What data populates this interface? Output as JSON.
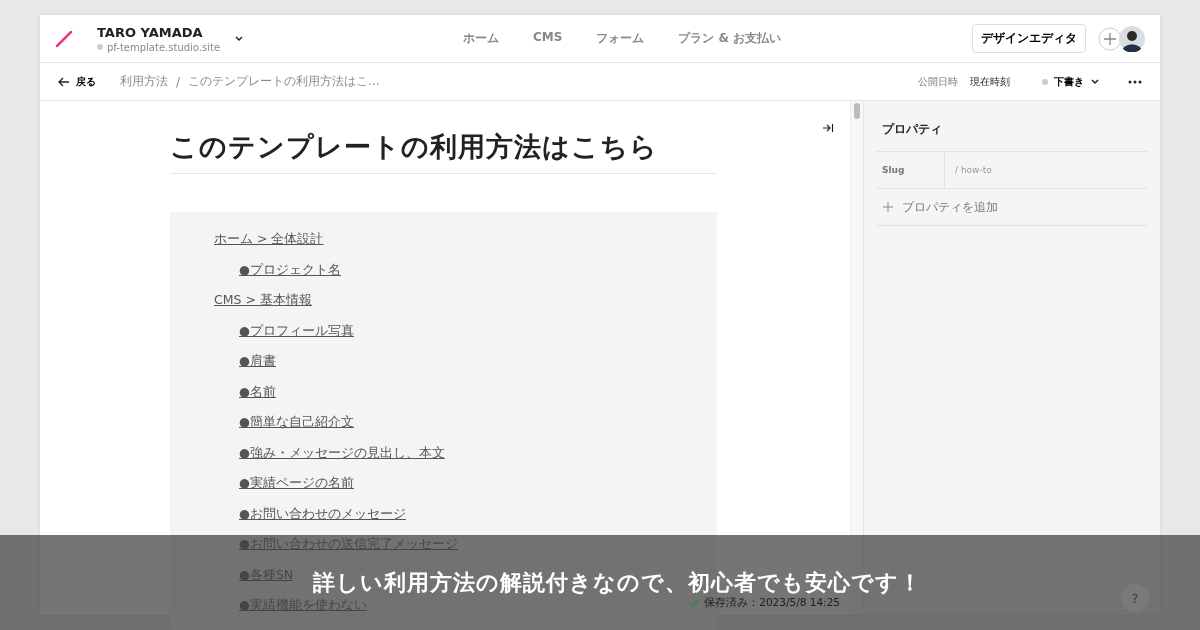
{
  "header": {
    "site_name": "TARO YAMADA",
    "site_url": "pf-template.studio.site",
    "nav": [
      {
        "label": "ホーム",
        "selected": false
      },
      {
        "label": "CMS",
        "selected": false
      },
      {
        "label": "フォーム",
        "selected": false
      },
      {
        "label": "プラン & お支払い",
        "selected": false
      }
    ],
    "design_button": "デザインエディタ"
  },
  "subbar": {
    "back": "戻る",
    "breadcrumbs": [
      "利用方法",
      "このテンプレートの利用方法はこ..."
    ],
    "breadcrumb_separator": "/",
    "publish_label": "公開日時",
    "publish_value": "現在時刻",
    "status": "下書き"
  },
  "editor": {
    "title": "このテンプレートの利用方法はこちら",
    "links": [
      {
        "text": "ホーム > 全体設計",
        "children": [
          {
            "text": "●プロジェクト名"
          }
        ]
      },
      {
        "text": "CMS > 基本情報",
        "children": [
          {
            "text": "●プロフィール写真"
          },
          {
            "text": "●肩書"
          },
          {
            "text": "●名前"
          },
          {
            "text": "●簡単な自己紹介文"
          },
          {
            "text": "●強み・メッセージの見出し、本文"
          },
          {
            "text": "●実績ページの名前"
          },
          {
            "text": "●お問い合わせのメッセージ"
          },
          {
            "text": "●お問い合わせの送信完了メッセージ"
          },
          {
            "text": "●各種SN"
          },
          {
            "text": "●実績機能を使わない"
          }
        ]
      }
    ],
    "save_status": "保存済み：2023/5/8 14:25"
  },
  "properties": {
    "title": "プロパティ",
    "fields": [
      {
        "label": "Slug",
        "value": "/ how-to"
      }
    ],
    "add": "プロパティを追加"
  },
  "help": "?",
  "banner": "詳しい利用方法の解説付きなので、初心者でも安心です！"
}
